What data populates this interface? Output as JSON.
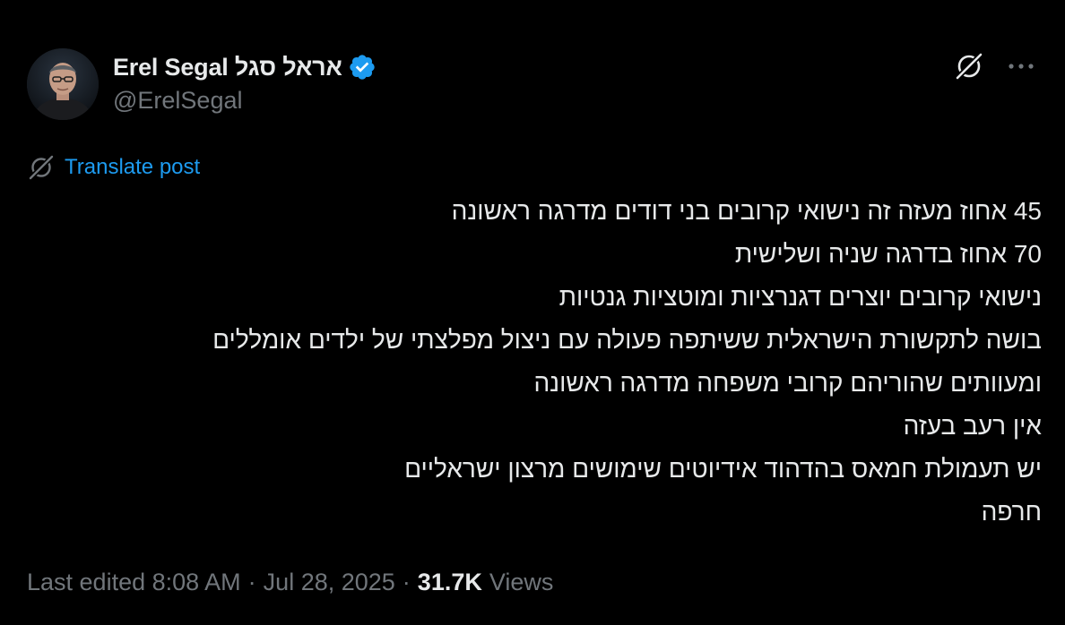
{
  "author": {
    "display_name": "Erel Segal אראל סגל",
    "handle": "@ErelSegal",
    "verified": true,
    "avatar": "profile-photo"
  },
  "actions": {
    "grok_icon": "grok-icon",
    "more_icon": "more-horizontal-icon"
  },
  "translate": {
    "label": "Translate post",
    "icon": "grok-icon"
  },
  "post": {
    "lines": [
      "45 אחוז מעזה זה נישואי קרובים בני דודים מדרגה ראשונה",
      "70 אחוז בדרגה שניה ושלישית",
      "נישואי קרובים יוצרים דגנרציות ומוטציות גנטיות",
      "בושה לתקשורת הישראלית ששיתפה פעולה עם ניצול מפלצתי של ילדים אומללים",
      "ומעוותים שהוריהם קרובי משפחה מדרגה ראשונה",
      "אין רעב בעזה",
      "יש תעמולת חמאס בהדהוד אידיוטים שימושים מרצון ישראליים",
      "חרפה"
    ]
  },
  "meta": {
    "edited": "Last edited 8:08 AM",
    "separator": "·",
    "date": "Jul 28, 2025",
    "views_count": "31.7K",
    "views_label": "Views"
  },
  "colors": {
    "background": "#000000",
    "text_primary": "#e7e9ea",
    "text_secondary": "#71767b",
    "accent": "#1d9bf0"
  }
}
